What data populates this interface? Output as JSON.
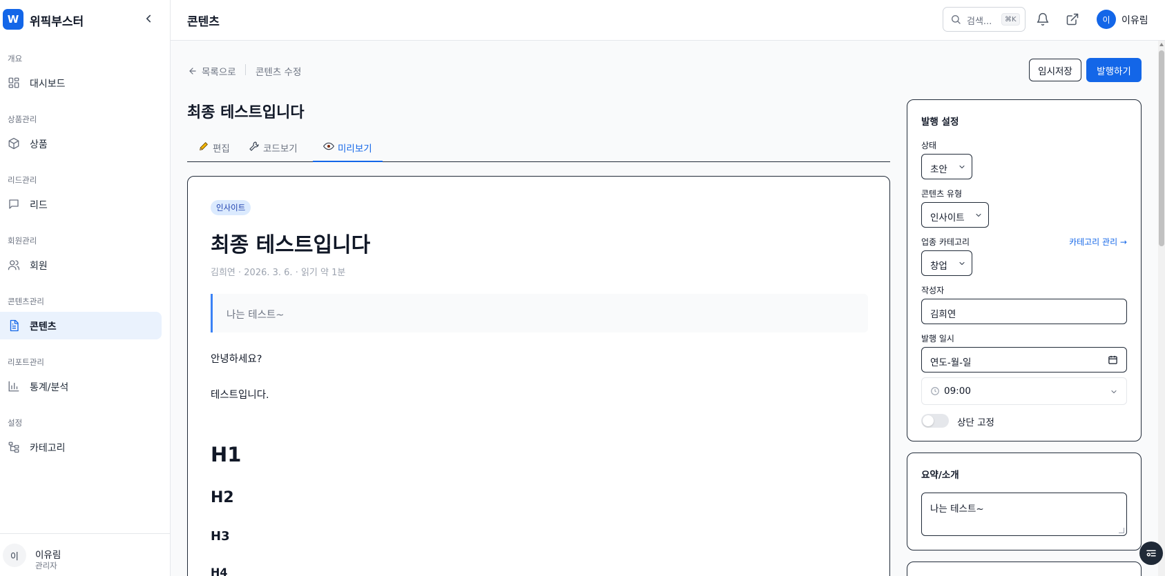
{
  "brand": {
    "logo": "W",
    "name": "위픽부스터"
  },
  "sidebar": {
    "sections": [
      {
        "title": "개요",
        "item": {
          "label": "대시보드",
          "icon": "dashboard-icon"
        }
      },
      {
        "title": "상품관리",
        "item": {
          "label": "상품",
          "icon": "package-icon"
        }
      },
      {
        "title": "리드관리",
        "item": {
          "label": "리드",
          "icon": "message-icon"
        }
      },
      {
        "title": "회원관리",
        "item": {
          "label": "회원",
          "icon": "users-icon"
        }
      },
      {
        "title": "콘텐츠관리",
        "item": {
          "label": "콘텐츠",
          "icon": "document-icon"
        }
      },
      {
        "title": "리포트관리",
        "item": {
          "label": "통계/분석",
          "icon": "chart-icon"
        }
      },
      {
        "title": "설정",
        "item": {
          "label": "카테고리",
          "icon": "category-tree-icon"
        }
      }
    ],
    "active_item": "콘텐츠",
    "user": {
      "initial": "이",
      "name": "이유림",
      "role": "관리자"
    }
  },
  "topbar": {
    "title": "콘텐츠",
    "search": {
      "placeholder": "검색...",
      "shortcut": "⌘K"
    },
    "user": {
      "initial": "이",
      "name": "이유림"
    }
  },
  "breadcrumb": {
    "back": "목록으로",
    "current": "콘텐츠 수정"
  },
  "actions": {
    "draft": "임시저장",
    "publish": "발행하기"
  },
  "content_title": "최종 테스트입니다",
  "tabs": [
    {
      "label": "편집",
      "icon": "pencil-icon"
    },
    {
      "label": "코드보기",
      "icon": "wrench-icon"
    },
    {
      "label": "미리보기",
      "icon": "eye-icon"
    }
  ],
  "active_tab": "미리보기",
  "preview": {
    "badge": "인사이트",
    "title": "최종 테스트입니다",
    "meta": "김희연 · 2026. 3. 6. · 읽기 약 1분",
    "quote": "나는 테스트~",
    "paragraphs": [
      "안녕하세요?",
      "테스트입니다."
    ],
    "headings": [
      "H1",
      "H2",
      "H3",
      "H4"
    ]
  },
  "publish_settings": {
    "title": "발행 설정",
    "status": {
      "label": "상태",
      "value": "초안"
    },
    "content_type": {
      "label": "콘텐츠 유형",
      "value": "인사이트"
    },
    "industry": {
      "label": "업종 카테고리",
      "value": "창업",
      "manage_link": "카테고리 관리 →"
    },
    "author": {
      "label": "작성자",
      "value": "김희연"
    },
    "publish_date": {
      "label": "발행 일시",
      "value": "연도-월-일",
      "time": "09:00"
    },
    "pin": {
      "label": "상단 고정",
      "on": false
    }
  },
  "summary": {
    "title": "요약/소개",
    "value": "나는 테스트~"
  },
  "colors": {
    "accent": "#1366e8",
    "border": "#1f2937",
    "badge_bg": "#dbeafe"
  }
}
